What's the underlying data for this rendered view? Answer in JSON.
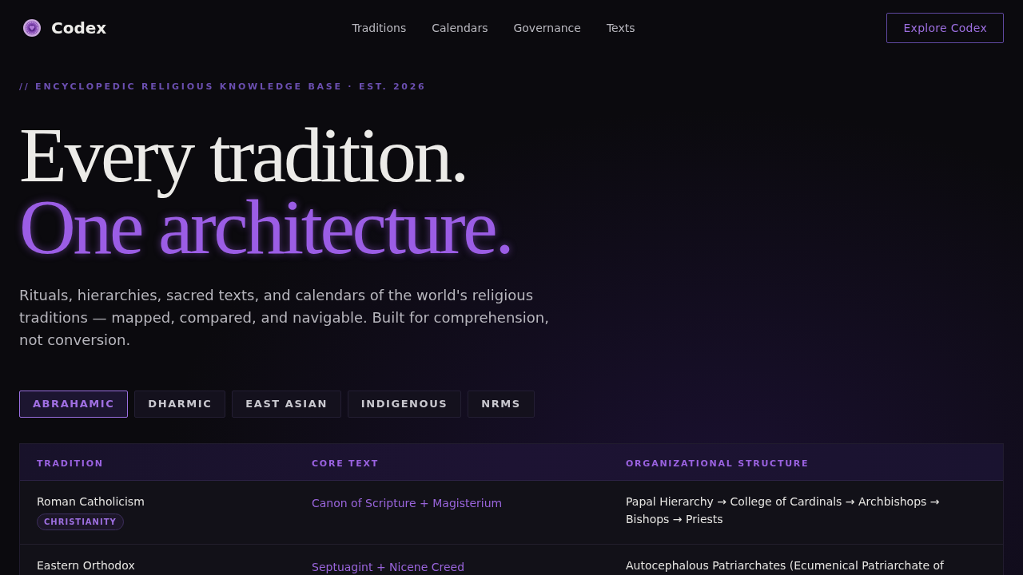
{
  "header": {
    "logo": "Codex",
    "nav": [
      {
        "label": "Traditions"
      },
      {
        "label": "Calendars"
      },
      {
        "label": "Governance"
      },
      {
        "label": "Texts"
      }
    ],
    "cta": "Explore Codex"
  },
  "hero": {
    "eyebrow": "// ENCYCLOPEDIC RELIGIOUS KNOWLEDGE BASE · EST. 2026",
    "title_line_1": "Every tradition.",
    "title_line_2": "One architecture.",
    "lead": "Rituals, hierarchies, sacred texts, and calendars of the world's religious traditions — mapped, compared, and navigable. Built for comprehension, not conversion."
  },
  "tabs": [
    {
      "label": "ABRAHAMIC",
      "selected": true
    },
    {
      "label": "DHARMIC",
      "selected": false
    },
    {
      "label": "EAST ASIAN",
      "selected": false
    },
    {
      "label": "INDIGENOUS",
      "selected": false
    },
    {
      "label": "NRMS",
      "selected": false
    }
  ],
  "table": {
    "columns": [
      "TRADITION",
      "CORE TEXT",
      "ORGANIZATIONAL STRUCTURE"
    ],
    "rows": [
      {
        "tradition": "Roman Catholicism",
        "tag": "CHRISTIANITY",
        "core_text": "Canon of Scripture + Magisterium",
        "structure": "Papal Hierarchy → College of Cardinals → Archbishops → Bishops → Priests"
      },
      {
        "tradition": "Eastern Orthodox",
        "core_text": "Septuagint + Nicene Creed",
        "structure": "Autocephalous Patriarchates (Ecumenical Patriarchate of"
      }
    ]
  }
}
